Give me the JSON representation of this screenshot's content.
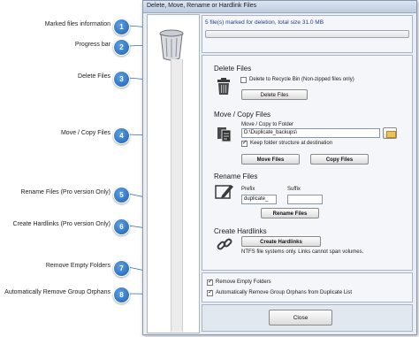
{
  "window": {
    "title": "Delete, Move, Rename or Hardlink Files"
  },
  "callouts": [
    {
      "number": "1",
      "label": "Marked files information"
    },
    {
      "number": "2",
      "label": "Progress bar"
    },
    {
      "number": "3",
      "label": "Delete Files"
    },
    {
      "number": "4",
      "label": "Move / Copy Files"
    },
    {
      "number": "5",
      "label": "Rename Files (Pro version Only)"
    },
    {
      "number": "6",
      "label": "Create Hardlinks (Pro version Only)"
    },
    {
      "number": "7",
      "label": "Remove Empty Folders"
    },
    {
      "number": "8",
      "label": "Automatically Remove Group Orphans"
    }
  ],
  "status": {
    "text": "5 file(s) marked for deletion, total size 31.0 MB",
    "progress_fraction": 0.0
  },
  "delete": {
    "title": "Delete Files",
    "recycle_label": "Delete to Recycle Bin (Non-zipped files only)",
    "recycle_checked": false,
    "button": "Delete Files"
  },
  "move_copy": {
    "title": "Move / Copy Files",
    "folder_label": "Move / Copy to Folder",
    "folder_value": "D:\\Duplicate_backups\\",
    "keep_structure_label": "Keep folder structure at destination",
    "keep_structure_checked": true,
    "move_button": "Move Files",
    "copy_button": "Copy Files"
  },
  "rename": {
    "title": "Rename Files",
    "prefix_label": "Prefix",
    "suffix_label": "Suffix",
    "prefix_value": "duplicate_",
    "suffix_value": "",
    "button": "Rename Files"
  },
  "hardlinks": {
    "title": "Create Hardlinks",
    "button": "Create Hardlinks",
    "note": "NTFS file systems only.  Links cannot span volumes."
  },
  "options": {
    "remove_empty_label": "Remove Empty Folders",
    "remove_empty_checked": true,
    "remove_orphans_label": "Automatically Remove Group Orphans from Duplicate List",
    "remove_orphans_checked": true
  },
  "close_button": "Close",
  "colors": {
    "badge": "#1f5fae",
    "callout_line": "#2a6dbd",
    "status_text": "#1f3f8f"
  }
}
